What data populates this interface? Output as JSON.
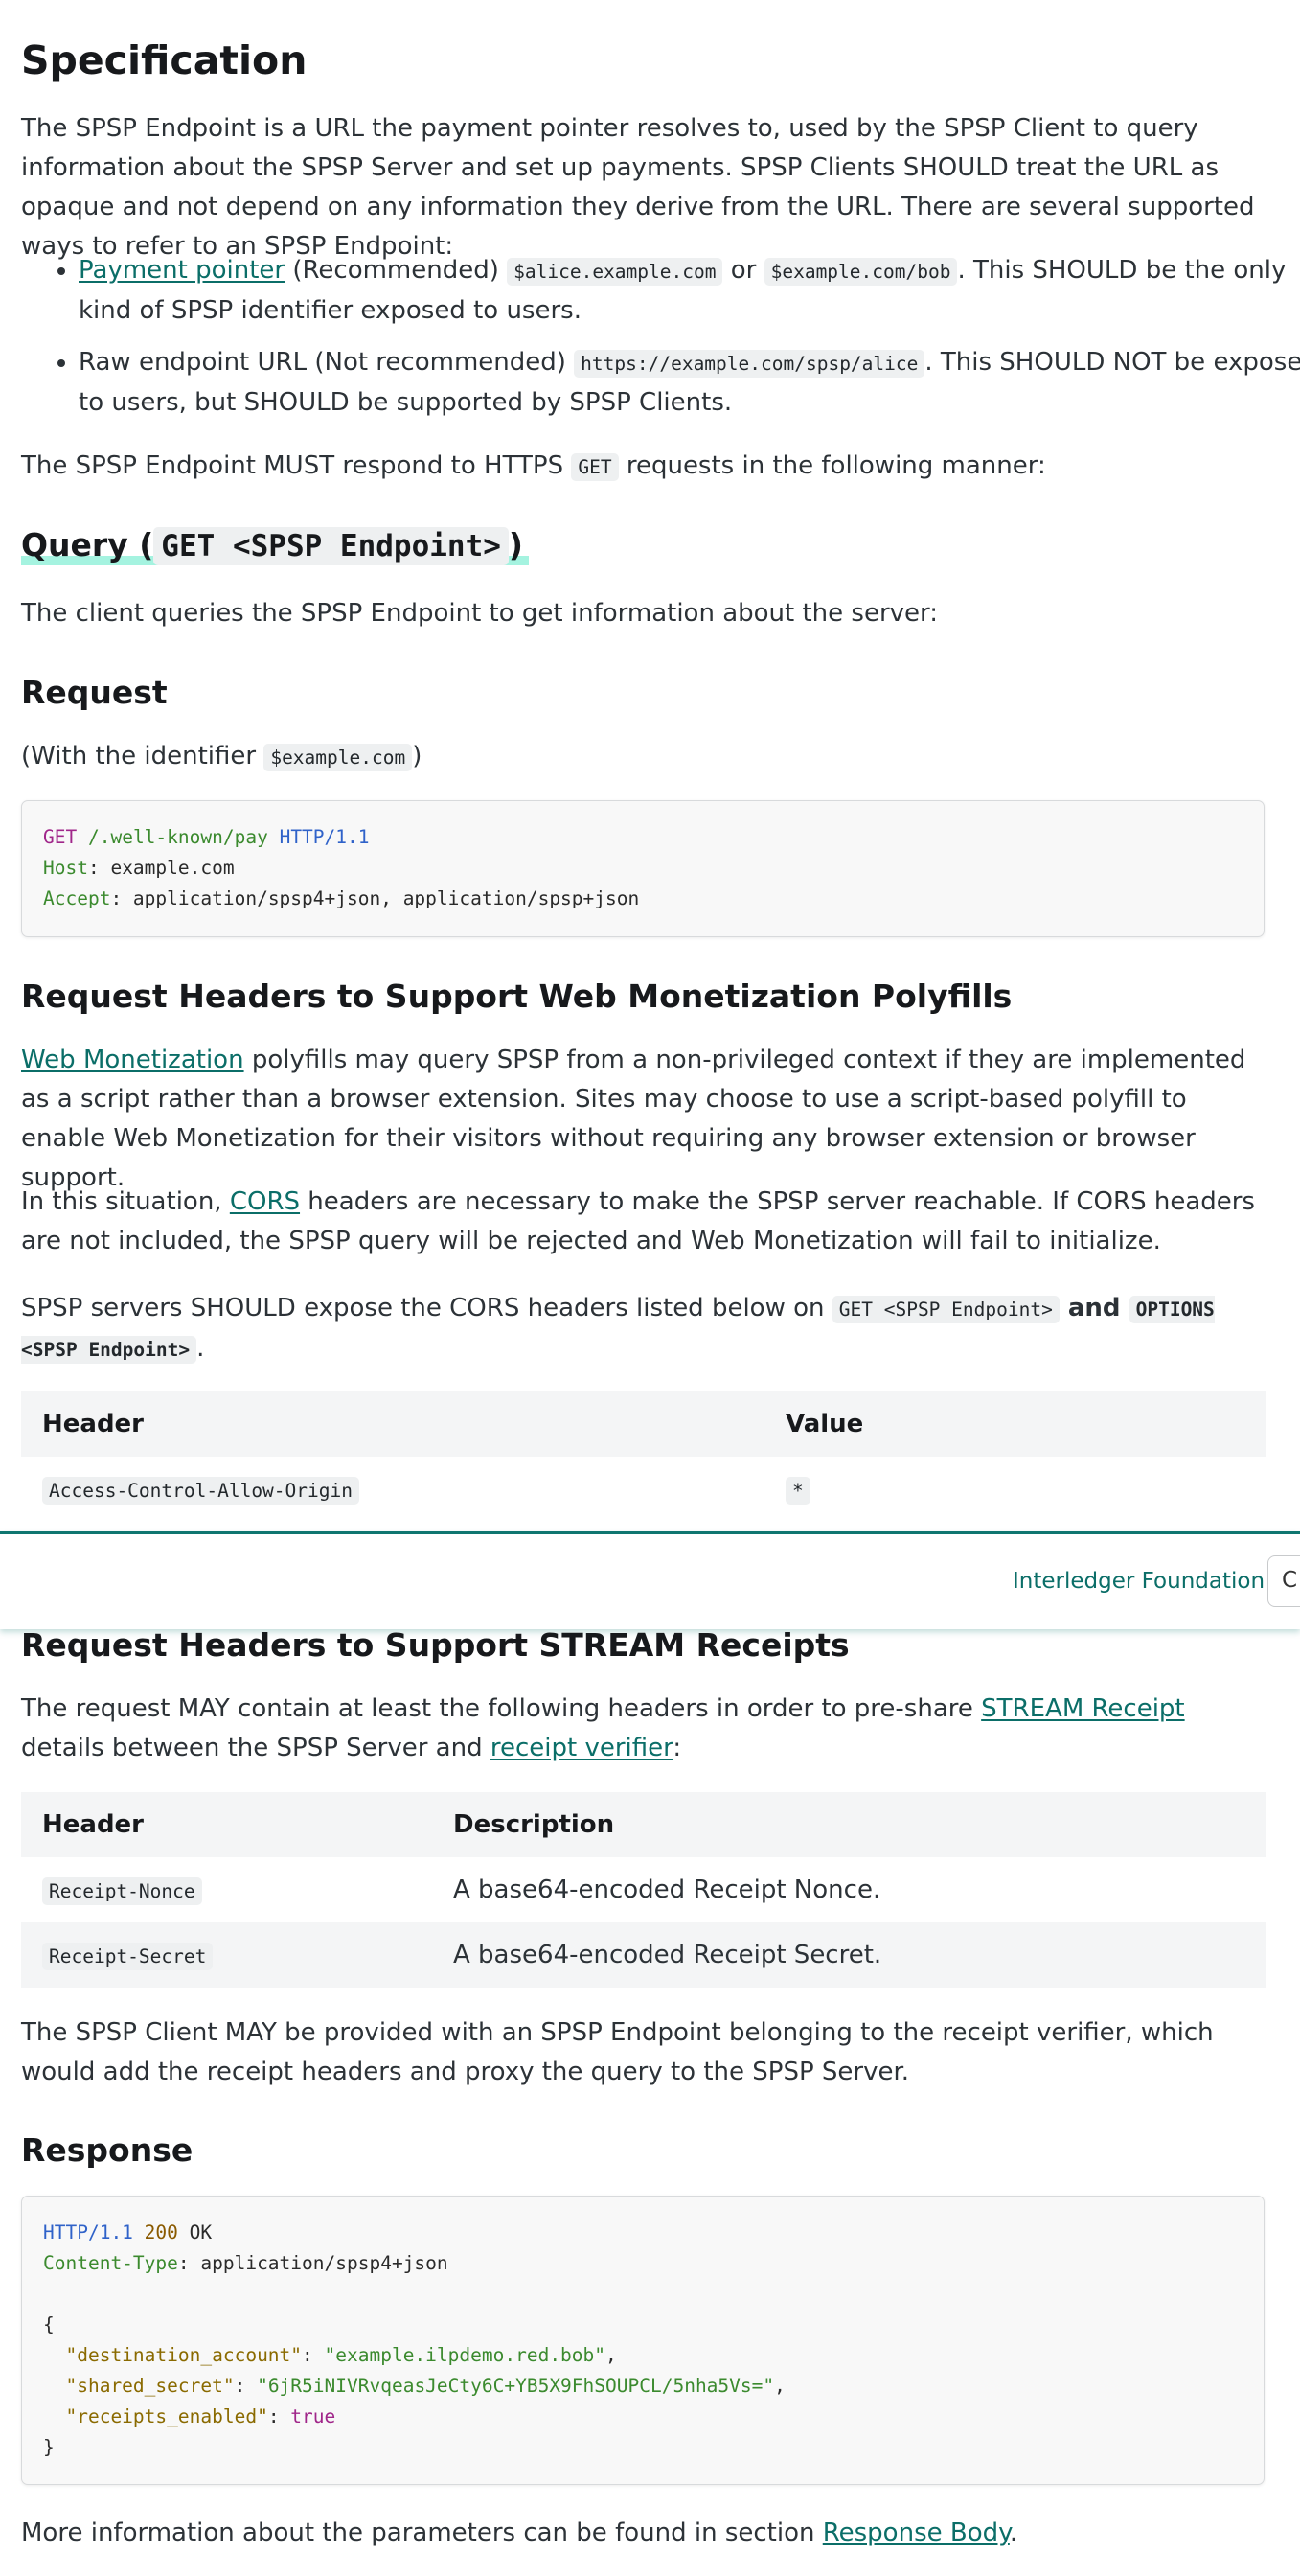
{
  "spec": {
    "title": "Specification",
    "intro": "The SPSP Endpoint is a URL the payment pointer resolves to, used by the SPSP Client to query information about the SPSP Server and set up payments. SPSP Clients SHOULD treat the URL as opaque and not depend on any information they derive from the URL. There are several supported ways to refer to an SPSP Endpoint:",
    "bullet1_link": "Payment pointer",
    "bullet1_text1": " (Recommended) ",
    "bullet1_code1": "$alice.example.com",
    "bullet1_or": " or ",
    "bullet1_code2": "$example.com/bob",
    "bullet1_text2": ". This SHOULD be the only kind of SPSP identifier exposed to users.",
    "bullet2_text1": "Raw endpoint URL (Not recommended) ",
    "bullet2_code": "https://example.com/spsp/alice",
    "bullet2_text2": ". This SHOULD NOT be exposed to users, but SHOULD be supported by SPSP Clients.",
    "respond_text1": "The SPSP Endpoint MUST respond to HTTPS ",
    "respond_code": "GET",
    "respond_text2": " requests in the following manner:"
  },
  "query": {
    "heading_text": "Query",
    "heading_paren_open": " (",
    "heading_code": "GET <SPSP Endpoint>",
    "heading_paren_close": ")",
    "desc": "The client queries the SPSP Endpoint to get information about the server:"
  },
  "request": {
    "heading": "Request",
    "note_text1": "(With the identifier ",
    "note_code": "$example.com",
    "note_text2": ")",
    "code": {
      "method": "GET",
      "path": "/.well-known/pay",
      "proto": "HTTP/1.1",
      "host_key": "Host",
      "host_val": ": example.com",
      "accept_key": "Accept",
      "accept_val": ": application/spsp4+json, application/spsp+json"
    }
  },
  "polyfills": {
    "heading": "Request Headers to Support Web Monetization Polyfills",
    "p1_link": "Web Monetization",
    "p1_text": " polyfills may query SPSP from a non-privileged context if they are implemented as a script rather than a browser extension. Sites may choose to use a script-based polyfill to enable Web Monetization for their visitors without requiring any browser extension or browser support.",
    "p2_text1": "In this situation, ",
    "p2_link": "CORS",
    "p2_text2": " headers are necessary to make the SPSP server reachable. If CORS headers are not included, the SPSP query will be rejected and Web Monetization will fail to initialize.",
    "p3_text1": "SPSP servers SHOULD expose the CORS headers listed below on ",
    "p3_code1": "GET <SPSP Endpoint>",
    "p3_and": " and ",
    "p3_code2": "OPTIONS <SPSP Endpoint>",
    "p3_text2": ".",
    "table": {
      "col1": "Header",
      "col2": "Value",
      "rows": [
        {
          "header": "Access-Control-Allow-Origin",
          "value": "*"
        }
      ]
    }
  },
  "navbar": {
    "link": "Interledger Foundation",
    "search_glyph": "C"
  },
  "receipts": {
    "heading": "Request Headers to Support STREAM Receipts",
    "p1_text1": "The request MAY contain at least the following headers in order to pre-share ",
    "p1_link1": "STREAM Receipt",
    "p1_text2": " details between the SPSP Server and ",
    "p1_link2": "receipt verifier",
    "p1_text3": ":",
    "table": {
      "col1": "Header",
      "col2": "Description",
      "rows": [
        {
          "header": "Receipt-Nonce",
          "desc": "A base64-encoded Receipt Nonce."
        },
        {
          "header": "Receipt-Secret",
          "desc": "A base64-encoded Receipt Secret."
        }
      ]
    },
    "p2": "The SPSP Client MAY be provided with an SPSP Endpoint belonging to the receipt verifier, which would add the receipt headers and proxy the query to the SPSP Server."
  },
  "response": {
    "heading": "Response",
    "code": {
      "proto": "HTTP/1.1",
      "status": "200",
      "status_text": " OK",
      "ct_key": "Content-Type",
      "ct_val": ": application/spsp4+json",
      "open": "{",
      "k1": "\"destination_account\"",
      "v1": "\"example.ilpdemo.red.bob\"",
      "k2": "\"shared_secret\"",
      "v2": "\"6jR5iNIVRvqeasJeCty6C+YB5X9FhSOUPCL/5nha5Vs=\"",
      "k3": "\"receipts_enabled\"",
      "v3": "true",
      "close": "}"
    },
    "more_text1": "More information about the parameters can be found in section ",
    "more_link": "Response Body",
    "more_text2": "."
  }
}
